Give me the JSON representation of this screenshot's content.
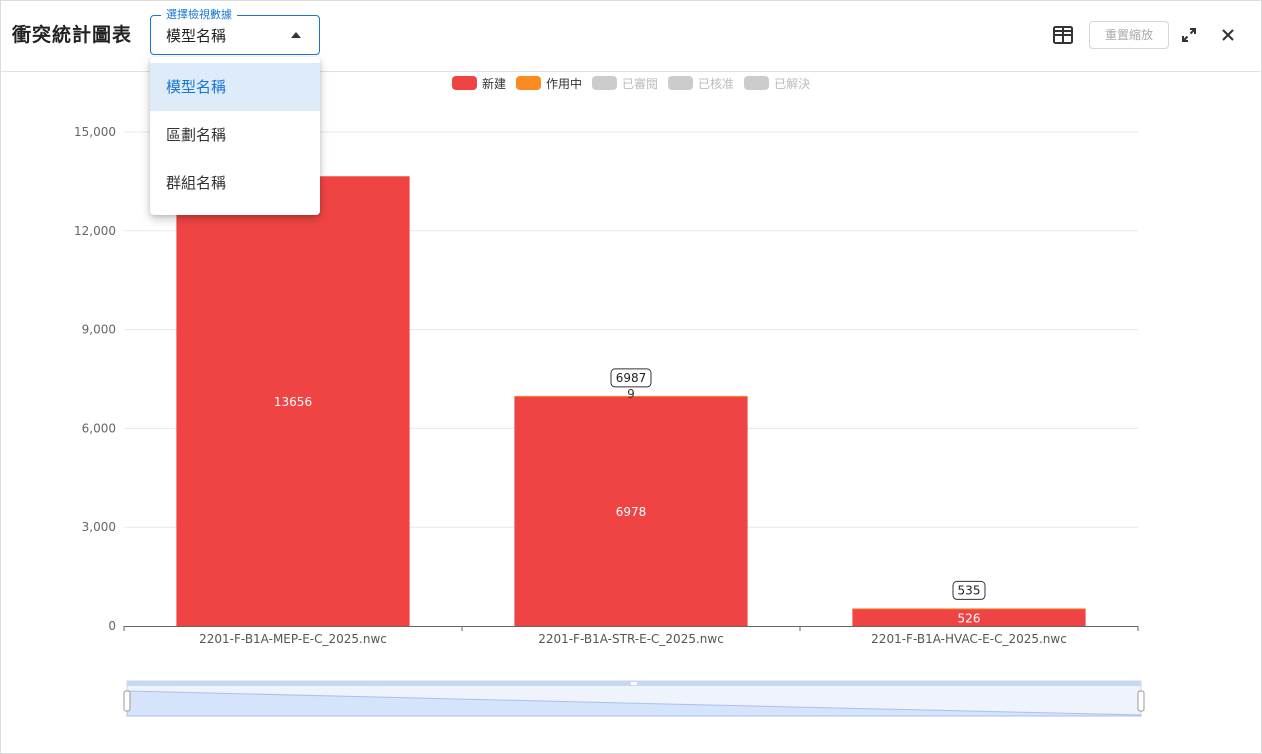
{
  "header": {
    "title": "衝突統計圖表",
    "select": {
      "label": "選擇檢視數據",
      "value": "模型名稱",
      "options": [
        "模型名稱",
        "區劃名稱",
        "群組名稱"
      ]
    },
    "reset_label": "重置縮放",
    "icons": {
      "table": "table-icon",
      "expand": "expand-icon",
      "close": "close-icon"
    }
  },
  "colors": {
    "new": "#f04444",
    "active": "#fa8a22",
    "inactive": "#cccccc",
    "accent": "#1976d2",
    "datazoom_fill": "#d5e3fb"
  },
  "chart_data": {
    "type": "bar",
    "stacked": true,
    "categories": [
      "2201-F-B1A-MEP-E-C_2025.nwc",
      "2201-F-B1A-STR-E-C_2025.nwc",
      "2201-F-B1A-HVAC-E-C_2025.nwc"
    ],
    "series": [
      {
        "name": "新建",
        "values": [
          13656,
          6978,
          526
        ],
        "color": "#f04444",
        "enabled": true
      },
      {
        "name": "作用中",
        "values": [
          0,
          9,
          9
        ],
        "color": "#fa8a22",
        "enabled": true
      },
      {
        "name": "已審閱",
        "values": [
          0,
          0,
          0
        ],
        "color": "#cccccc",
        "enabled": false
      },
      {
        "name": "已核准",
        "values": [
          0,
          0,
          0
        ],
        "color": "#cccccc",
        "enabled": false
      },
      {
        "name": "已解決",
        "values": [
          0,
          0,
          0
        ],
        "color": "#cccccc",
        "enabled": false
      }
    ],
    "segment_labels": [
      [
        "13656",
        "",
        ""
      ],
      [
        "6978",
        "9",
        ""
      ],
      [
        "526",
        "",
        ""
      ]
    ],
    "totals": [
      "",
      "6987",
      "535"
    ],
    "yticks": [
      "0",
      "3,000",
      "6,000",
      "9,000",
      "12,000",
      "15,000"
    ],
    "ylim": [
      0,
      15000
    ],
    "grid": true,
    "legend_position": "top-center",
    "datazoom": true
  }
}
